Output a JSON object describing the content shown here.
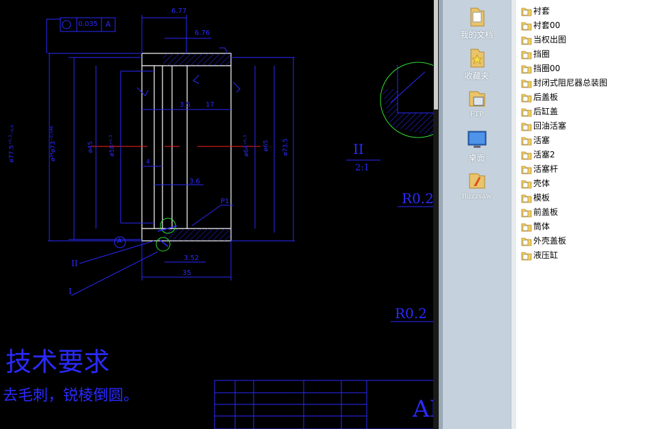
{
  "drawing": {
    "dims": {
      "d677": "6.77",
      "d676": "6.76",
      "tol": "0.035",
      "datum_a": "A",
      "d35": "3.5",
      "d17": "17",
      "d36": "3.6",
      "d4": "4",
      "d352": "3.52",
      "d35b": "35",
      "p1": "P1",
      "dia_outer": "ø77.5⁺⁰·³₋₀.₆",
      "dia_2": "ø²⁴ø73⁻⁰·⁰⁴⁶",
      "dia_inner1": "ø45",
      "dia_inner2": "ø58⁺⁰·³",
      "dia_r1": "ø64⁺⁰·³",
      "dia_r2": "ø65",
      "dia_r3": "ø73.5",
      "circ_a": "A",
      "label_ii": "II",
      "label_i": "I",
      "detail_label": "II",
      "detail_scale": "2:1",
      "r02a": "R0.2",
      "r02b": "R0.2"
    },
    "tech_title": "技术要求",
    "tech_note": "去毛刺，锐棱倒圆。",
    "title_block_text": "AI"
  },
  "places": [
    {
      "label": "我的文档",
      "icon": "documents-folder-icon"
    },
    {
      "label": "收藏夹",
      "icon": "favorites-star-icon"
    },
    {
      "label": "FTP",
      "icon": "ftp-icon"
    },
    {
      "label": "桌面",
      "icon": "desktop-monitor-icon"
    },
    {
      "label": "Buzzsaw",
      "icon": "buzzsaw-icon"
    }
  ],
  "files": [
    "衬套",
    "衬套00",
    "当权出图",
    "挡圈",
    "挡圈00",
    "封闭式阻尼器总装图",
    "后盖板",
    "后缸盖",
    "回油活塞",
    "活塞",
    "活塞2",
    "活塞杆",
    "壳体",
    "模板",
    "前盖板",
    "筒体",
    "外壳盖板",
    "液压缸"
  ],
  "colors": {
    "cad_bg": "#000000",
    "cad_line": "#2a2aff",
    "cad_white": "#ffffff",
    "cad_red": "#ff2020",
    "cad_green": "#30e030",
    "places_bg": "#c5d1dc"
  }
}
